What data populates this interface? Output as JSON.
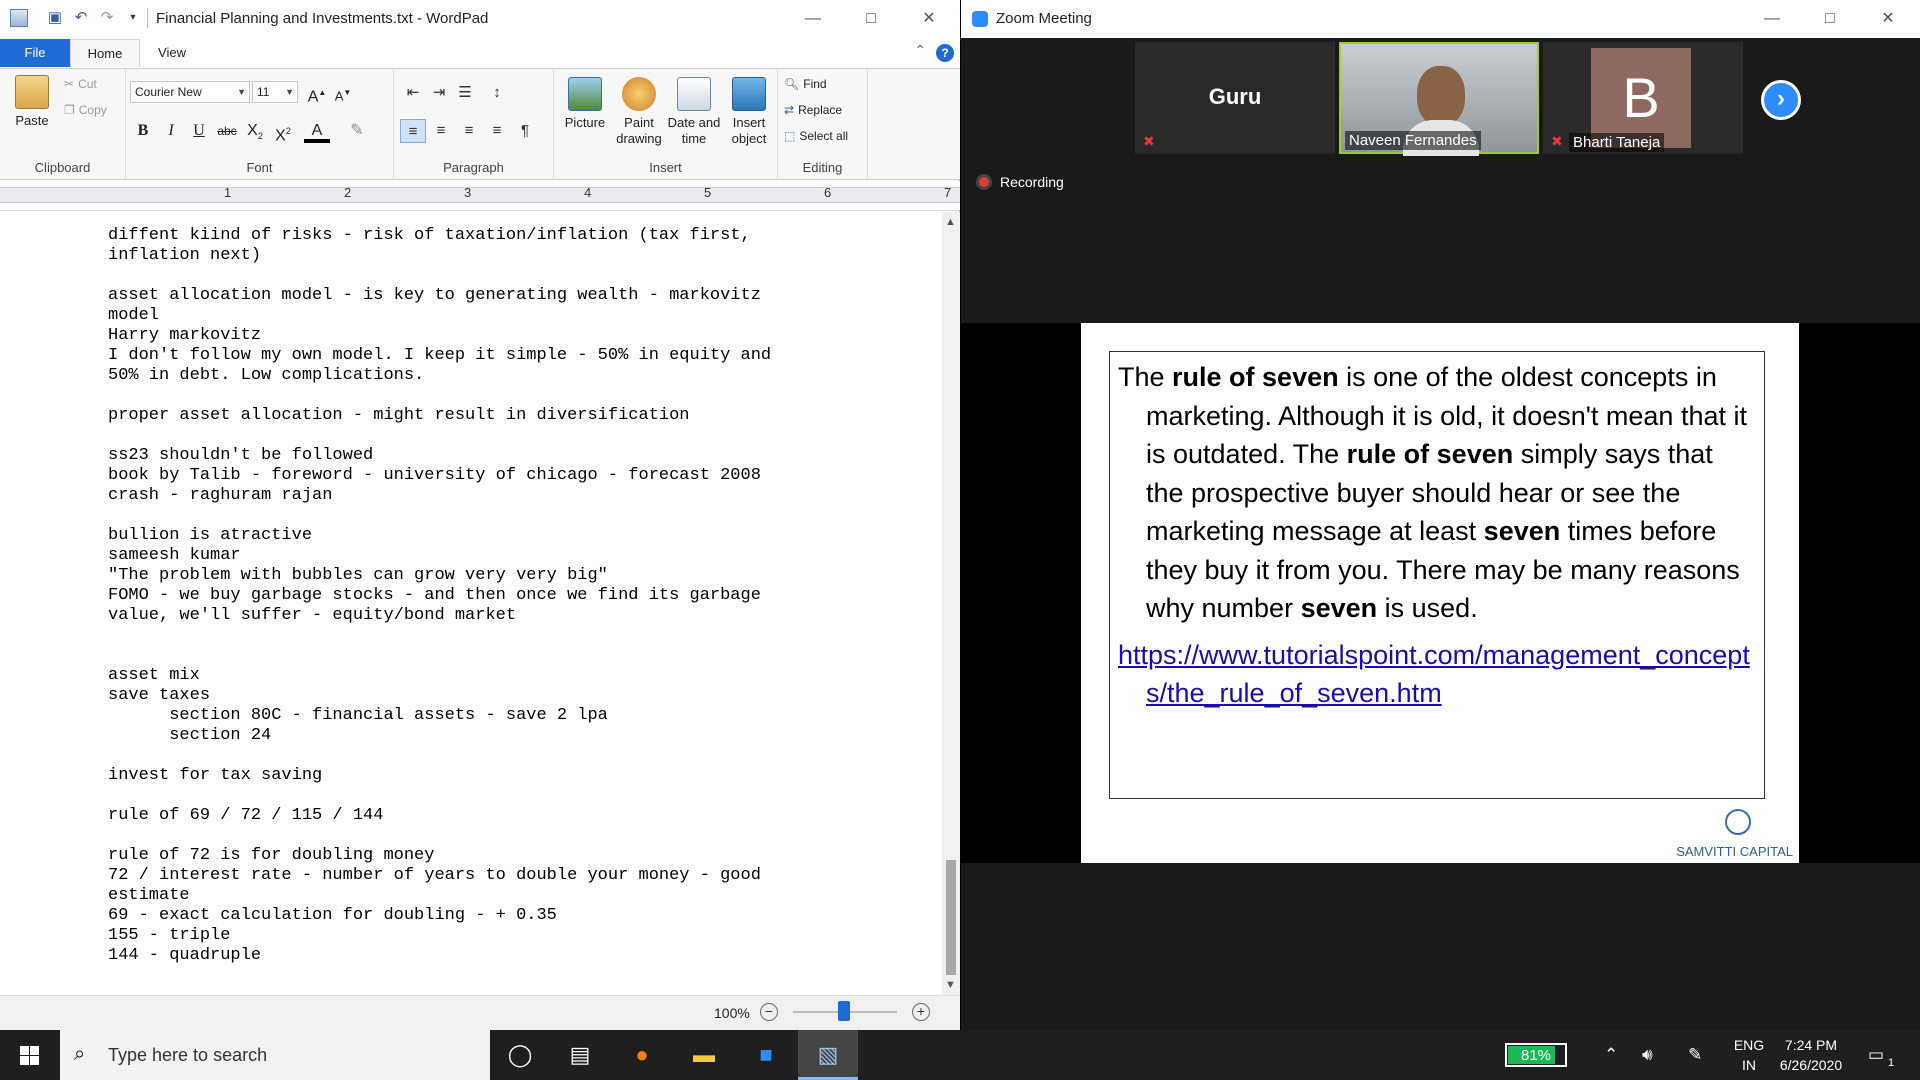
{
  "wordpad": {
    "title": "Financial Planning and Investments.txt - WordPad",
    "tabs": {
      "file": "File",
      "home": "Home",
      "view": "View"
    },
    "clipboard": {
      "paste": "Paste",
      "cut": "Cut",
      "copy": "Copy",
      "label": "Clipboard"
    },
    "font": {
      "family": "Courier New",
      "size": "11",
      "label": "Font"
    },
    "paragraph": {
      "label": "Paragraph"
    },
    "insert": {
      "picture": "Picture",
      "paint_drawing": "Paint drawing",
      "date_time": "Date and time",
      "insert_object": "Insert object",
      "label": "Insert"
    },
    "editing": {
      "find": "Find",
      "replace": "Replace",
      "select_all": "Select all",
      "label": "Editing"
    },
    "ruler_numbers": [
      "1",
      "2",
      "3",
      "4",
      "5",
      "6",
      "7"
    ],
    "document_text": "diffent kiind of risks - risk of taxation/inflation (tax first,\ninflation next)\n\nasset allocation model - is key to generating wealth - markovitz\nmodel\nHarry markovitz\nI don't follow my own model. I keep it simple - 50% in equity and\n50% in debt. Low complications.\n\nproper asset allocation - might result in diversification\n\nss23 shouldn't be followed\nbook by Talib - foreword - university of chicago - forecast 2008\ncrash - raghuram rajan\n\nbullion is atractive\nsameesh kumar\n\"The problem with bubbles can grow very very big\"\nFOMO - we buy garbage stocks - and then once we find its garbage\nvalue, we'll suffer - equity/bond market\n\n\nasset mix\nsave taxes\n      section 80C - financial assets - save 2 lpa\n      section 24\n\ninvest for tax saving\n\nrule of 69 / 72 / 115 / 144\n\nrule of 72 is for doubling money\n72 / interest rate - number of years to double your money - good\nestimate\n69 - exact calculation for doubling - + 0.35\n155 - triple\n144 - quadruple",
    "zoom_level": "100%"
  },
  "zoom": {
    "title": "Zoom Meeting",
    "participants": [
      {
        "name": "Guru"
      },
      {
        "name": "Naveen Fernandes"
      },
      {
        "name": "Bharti Taneja",
        "initial": "B"
      }
    ],
    "recording_label": "Recording",
    "slide": {
      "p1_a": "The ",
      "p1_b": "rule of seven",
      "p1_c": " is one of the oldest concepts in marketing. Although it is old, it doesn't mean that it is outdated. The ",
      "p1_d": "rule of seven",
      "p1_e": " simply says that the prospective buyer should hear or see the marketing message at least ",
      "p1_f": "seven",
      "p1_g": " times before they buy it from you. There may be many reasons why number ",
      "p1_h": "seven",
      "p1_i": " is used.",
      "link": "https://www.tutorialspoint.com/management_concepts/the_rule_of_seven.htm",
      "logo": "SAMVITTI CAPITAL"
    }
  },
  "taskbar": {
    "search_placeholder": "Type here to search",
    "battery": "81%",
    "language": "ENG",
    "region": "IN",
    "time": "7:24 PM",
    "date": "6/26/2020",
    "notifications": "1"
  }
}
